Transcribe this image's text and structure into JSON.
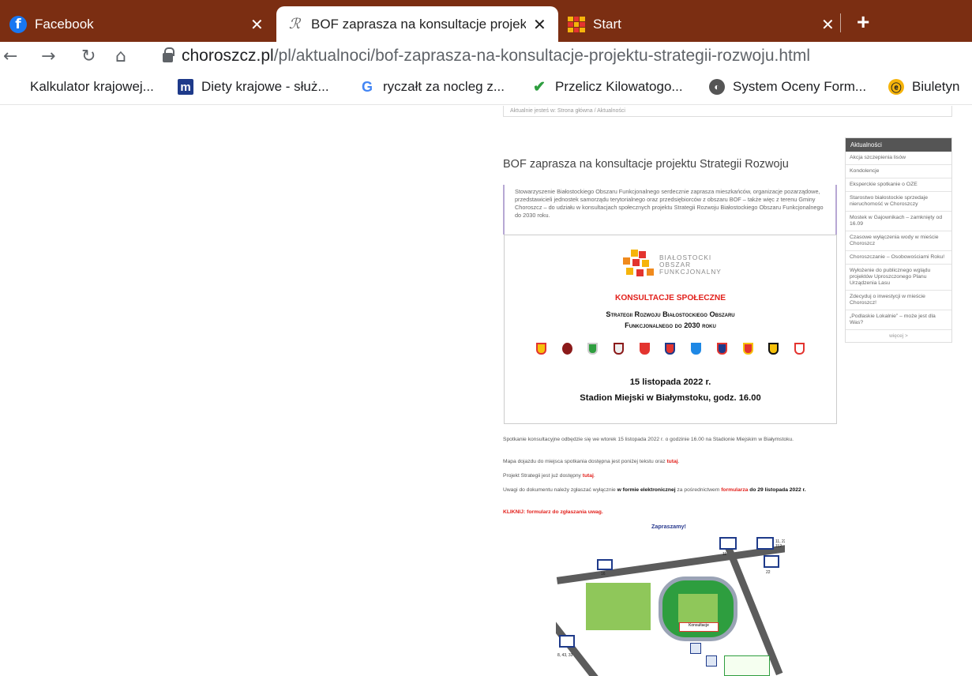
{
  "tabs": [
    {
      "title": "Facebook",
      "favicon": "facebook-icon",
      "close": "✕"
    },
    {
      "title": "BOF zaprasza na konsultacje projektu Strategii Rozwoju",
      "favicon": "r-script-icon",
      "close": "✕"
    },
    {
      "title": "Start",
      "favicon": "start-icon",
      "close": "✕"
    }
  ],
  "new_tab_label": "+",
  "toolbar": {
    "url_host": "choroszcz.pl",
    "url_path": "/pl/aktualnoci/bof-zaprasza-na-konsultacje-projektu-strategii-rozwoju.html"
  },
  "bookmarks": [
    {
      "label": "Kalkulator krajowej...",
      "icon": "grid-icon",
      "color": "#e3342f"
    },
    {
      "label": "Diety krajowe - służ...",
      "icon": "m-icon",
      "color": "#1e3a8a"
    },
    {
      "label": "ryczałt za nocleg z...",
      "icon": "google-icon",
      "color": "#4285f4"
    },
    {
      "label": "Przelicz Kilowatogo...",
      "icon": "checkmark-icon",
      "color": "#2e9e3f"
    },
    {
      "label": "System Oceny Form...",
      "icon": "globe-icon",
      "color": "#555555"
    },
    {
      "label": "Biuletyn",
      "icon": "b-icon",
      "color": "#f6b40b"
    }
  ],
  "breadcrumb": "Aktualnie jesteś w:  Strona główna  /  Aktualności",
  "article": {
    "title": "BOF zaprasza na konsultacje projektu Strategii Rozwoju",
    "intro": "Stowarzyszenie Białostockiego Obszaru Funkcjonalnego serdecznie zaprasza mieszkańców, organizacje pozarządowe, przedstawicieli jednostek samorządu terytorialnego oraz przedsiębiorców z obszaru BOF – także więc z terenu Gminy Choroszcz – do udziału w konsultacjach społecznych projektu Strategii Rozwoju Białostockiego Obszaru Funkcjonalnego do 2030 roku.",
    "poster": {
      "logo_line1": "BIAŁOSTOCKI",
      "logo_line2": "OBSZAR",
      "logo_line3": "FUNKCJONALNY",
      "heading": "KONSULTACJE SPOŁECZNE",
      "sub1": "Strategii Rozwoju Białostockiego Obszaru",
      "sub2": "Funkcjonalnego do 2030 roku",
      "date": "15 listopada 2022 r.",
      "place": "Stadion Miejski w Białymstoku, godz. 16.00"
    },
    "p1": "Spotkanie konsultacyjne odbędzie się we wtorek 15 listopada 2022 r. o godzinie 16.00 na Stadionie Miejskim w Białymstoku.",
    "p2_text": "Mapa dojazdu do miejsca spotkania dostępna jest poniżej tekstu oraz ",
    "p2_link": "tutaj",
    "p3_text": "Projekt Strategii jest już dostępny ",
    "p3_link": "tutaj",
    "p4_a": "Uwagi do dokumentu należy zgłaszać wyłącznie ",
    "p4_b": "w formie elektronicznej",
    "p4_c": " za pośrednictwem ",
    "p4_d": "formularza",
    "p4_e": " do 29 listopada 2022 r.",
    "p5": "KLIKNIJ: formularz do zgłaszania uwag.",
    "invite": "Zapraszamy!",
    "map_labels": [
      "11, 22, 112",
      "11",
      "22",
      "16",
      "8, 43, 33",
      "BOF",
      "Konsultacje"
    ]
  },
  "sidebar": {
    "heading": "Aktualności",
    "items": [
      "Akcja szczepienia lisów",
      "Kondolencje",
      "Eksperckie spotkanie o OZE",
      "Starostwo białostockie sprzedaje nieruchomość w Choroszczy",
      "Mostek w Gajownikach – zamknięty od 16.09",
      "Czasowe wyłączenia wody w mieście Choroszcz",
      "Choroszczanie – Osobowościami Roku!",
      "Wyłożenie do publicznego wglądu projektów Uproszczonego Planu Urządzenia Lasu",
      "Zdecyduj o inwestycji w mieście Choroszcz!",
      "„Podlaskie Lokalnie” – może jest dla Was?"
    ],
    "more": "więcej >"
  }
}
